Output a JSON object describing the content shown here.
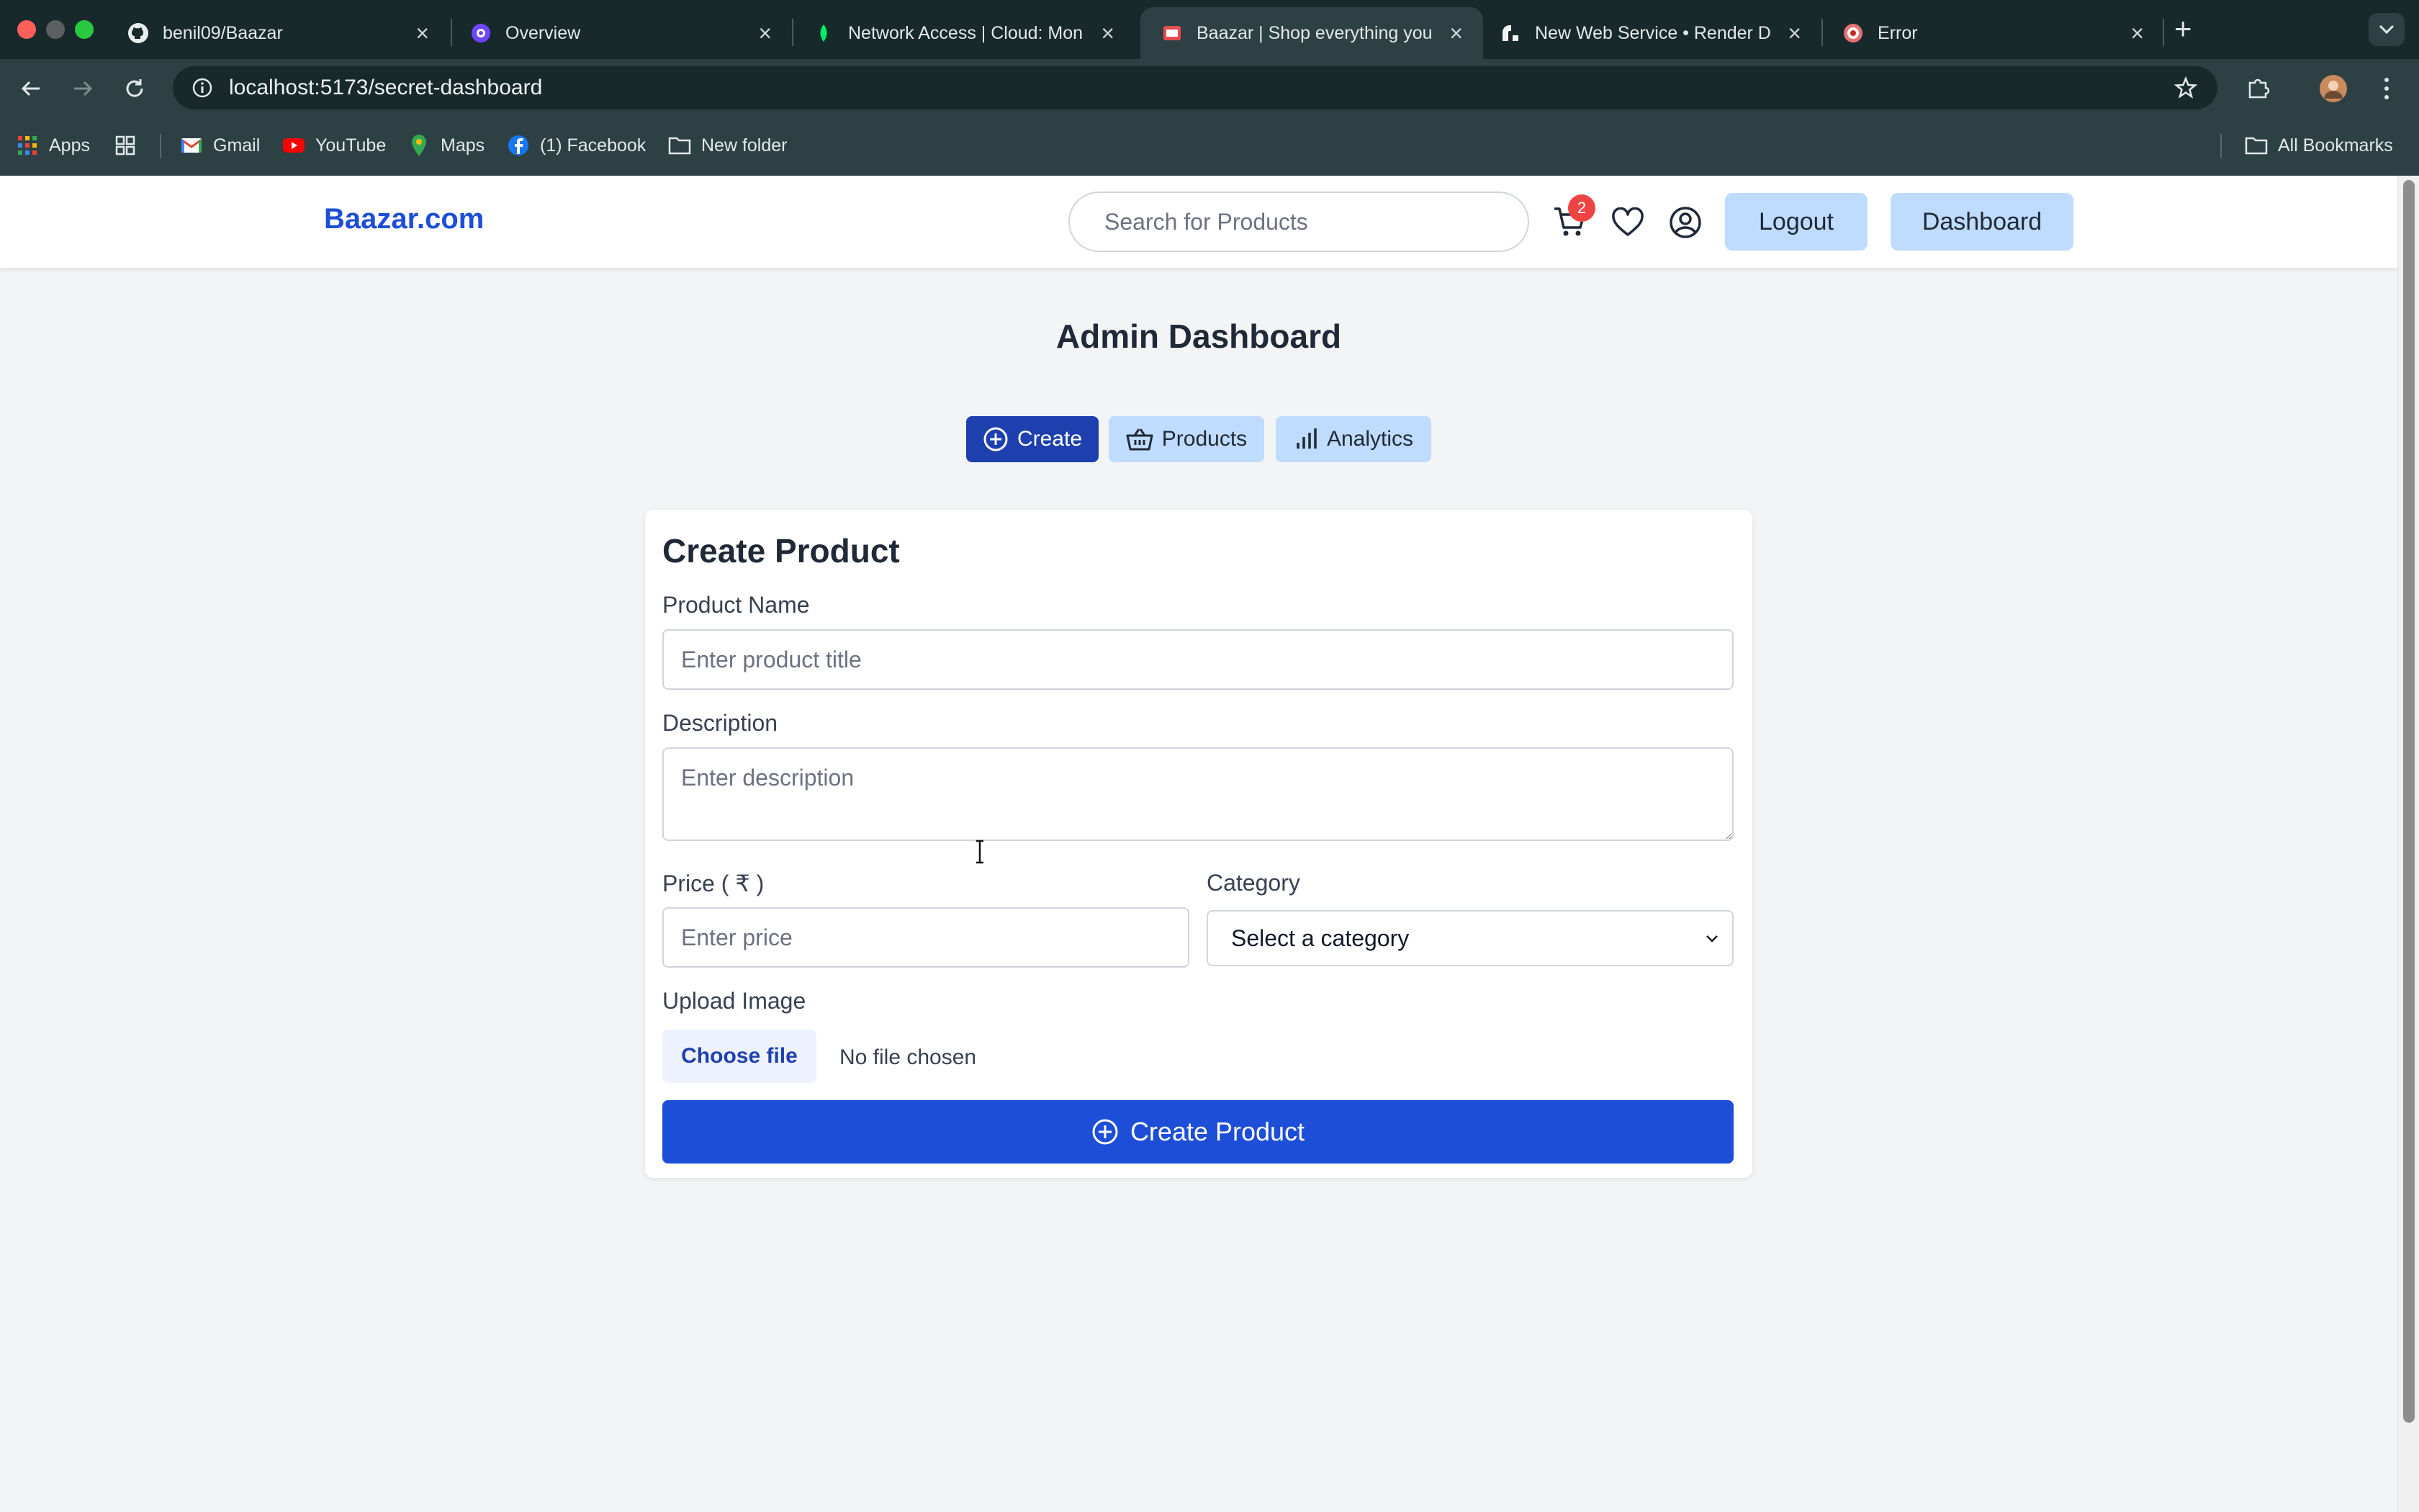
{
  "browser": {
    "tabs": [
      {
        "title": "benil09/Baazar",
        "icon": "github-icon",
        "active": false
      },
      {
        "title": "Overview",
        "icon": "clerk-icon",
        "active": false
      },
      {
        "title": "Network Access | Cloud: Mon",
        "icon": "mongodb-leaf-icon",
        "active": false
      },
      {
        "title": "Baazar | Shop everything you",
        "icon": "baazar-favicon",
        "active": true
      },
      {
        "title": "New Web Service • Render D",
        "icon": "render-icon",
        "active": false
      },
      {
        "title": "Error",
        "icon": "error-favicon",
        "active": false
      }
    ],
    "url": "localhost:5173/secret-dashboard",
    "bookmarks": [
      {
        "label": "Apps",
        "icon": "apps-grid-icon"
      },
      {
        "label": "",
        "icon": "tab-groups-icon"
      },
      {
        "label": "Gmail",
        "icon": "gmail-icon"
      },
      {
        "label": "YouTube",
        "icon": "youtube-icon"
      },
      {
        "label": "Maps",
        "icon": "maps-icon"
      },
      {
        "label": "(1) Facebook",
        "icon": "facebook-icon"
      },
      {
        "label": "New folder",
        "icon": "folder-icon"
      }
    ],
    "all_bookmarks": "All Bookmarks"
  },
  "site": {
    "brand": "Baazar.com",
    "search_placeholder": "Search for Products",
    "cart_count": "2",
    "logout_label": "Logout",
    "dashboard_label": "Dashboard"
  },
  "dashboard": {
    "title": "Admin Dashboard",
    "tabs": [
      {
        "label": "Create",
        "icon": "plus-circle-icon",
        "active": true
      },
      {
        "label": "Products",
        "icon": "basket-icon",
        "active": false
      },
      {
        "label": "Analytics",
        "icon": "bar-chart-icon",
        "active": false
      }
    ]
  },
  "form": {
    "title": "Create Product",
    "name_label": "Product Name",
    "name_placeholder": "Enter product title",
    "description_label": "Description",
    "description_placeholder": "Enter description",
    "price_label": "Price ( ₹ )",
    "price_placeholder": "Enter price",
    "category_label": "Category",
    "category_selected": "Select a category",
    "upload_label": "Upload Image",
    "choose_file": "Choose file",
    "no_file": "No file chosen",
    "submit_label": "Create Product"
  },
  "colors": {
    "brand": "#1d4ed8",
    "active_tab": "#1e40af",
    "light_button": "#bfdbfe",
    "badge": "#ef4444",
    "chrome_dark": "#18292c",
    "chrome_toolbar": "#2d4145"
  }
}
